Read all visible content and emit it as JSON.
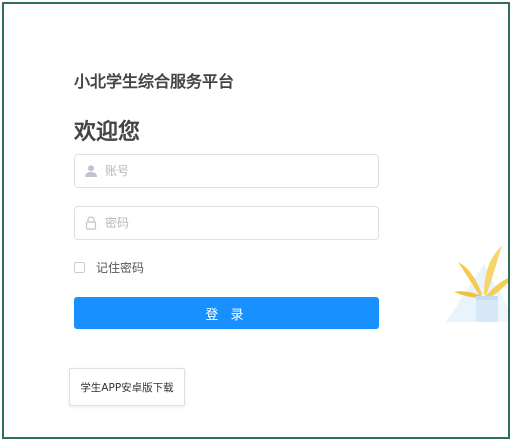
{
  "platform": {
    "title": "小北学生综合服务平台"
  },
  "login": {
    "heading": "欢迎您",
    "account_placeholder": "账号",
    "password_placeholder": "密码",
    "remember_label": "记住密码",
    "submit_label": "登 录"
  },
  "footer": {
    "download_label": "学生APP安卓版下载"
  },
  "colors": {
    "primary": "#1890ff",
    "frame_border": "#2f6f62",
    "plant_leaf": "#f5c94a",
    "pot": "#d6e8f7"
  },
  "icons": {
    "account": "user-icon",
    "password": "lock-icon",
    "decoration": "plant-illustration"
  }
}
